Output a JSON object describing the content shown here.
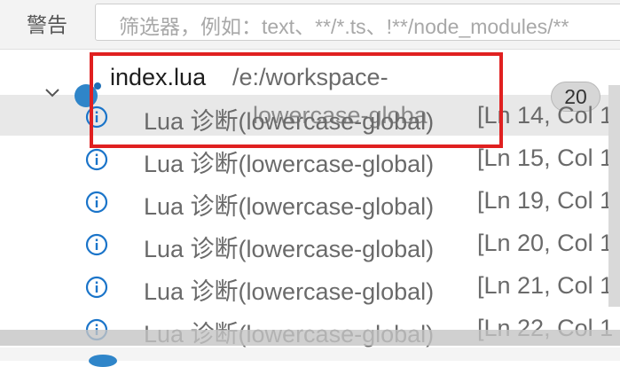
{
  "filter": {
    "label": "警告",
    "placeholder": "筛选器，例如：text、**/*.ts、!**/node_modules/**"
  },
  "file": {
    "name": "index.lua",
    "path": "/e:/workspace-",
    "count": "20"
  },
  "overlay": "lowercase-globa",
  "problems": [
    {
      "message": "Lua 诊断(lowercase-global)",
      "location": "[Ln 14, Col 1"
    },
    {
      "message": "Lua 诊断(lowercase-global)",
      "location": "[Ln 15, Col 1"
    },
    {
      "message": "Lua 诊断(lowercase-global)",
      "location": "[Ln 19, Col 1"
    },
    {
      "message": "Lua 诊断(lowercase-global)",
      "location": "[Ln 20, Col 1"
    },
    {
      "message": "Lua 诊断(lowercase-global)",
      "location": "[Ln 21, Col 1"
    },
    {
      "message": "Lua 诊断(lowercase-global)",
      "location": "[Ln 22, Col 1"
    }
  ],
  "icons": {
    "twisty": "chevron-down-icon",
    "problem": "info-icon",
    "file": "lua-file-icon"
  },
  "colors": {
    "info": "#1a74c9",
    "highlight": "#e02020",
    "file_icon": "#2f85c9"
  }
}
